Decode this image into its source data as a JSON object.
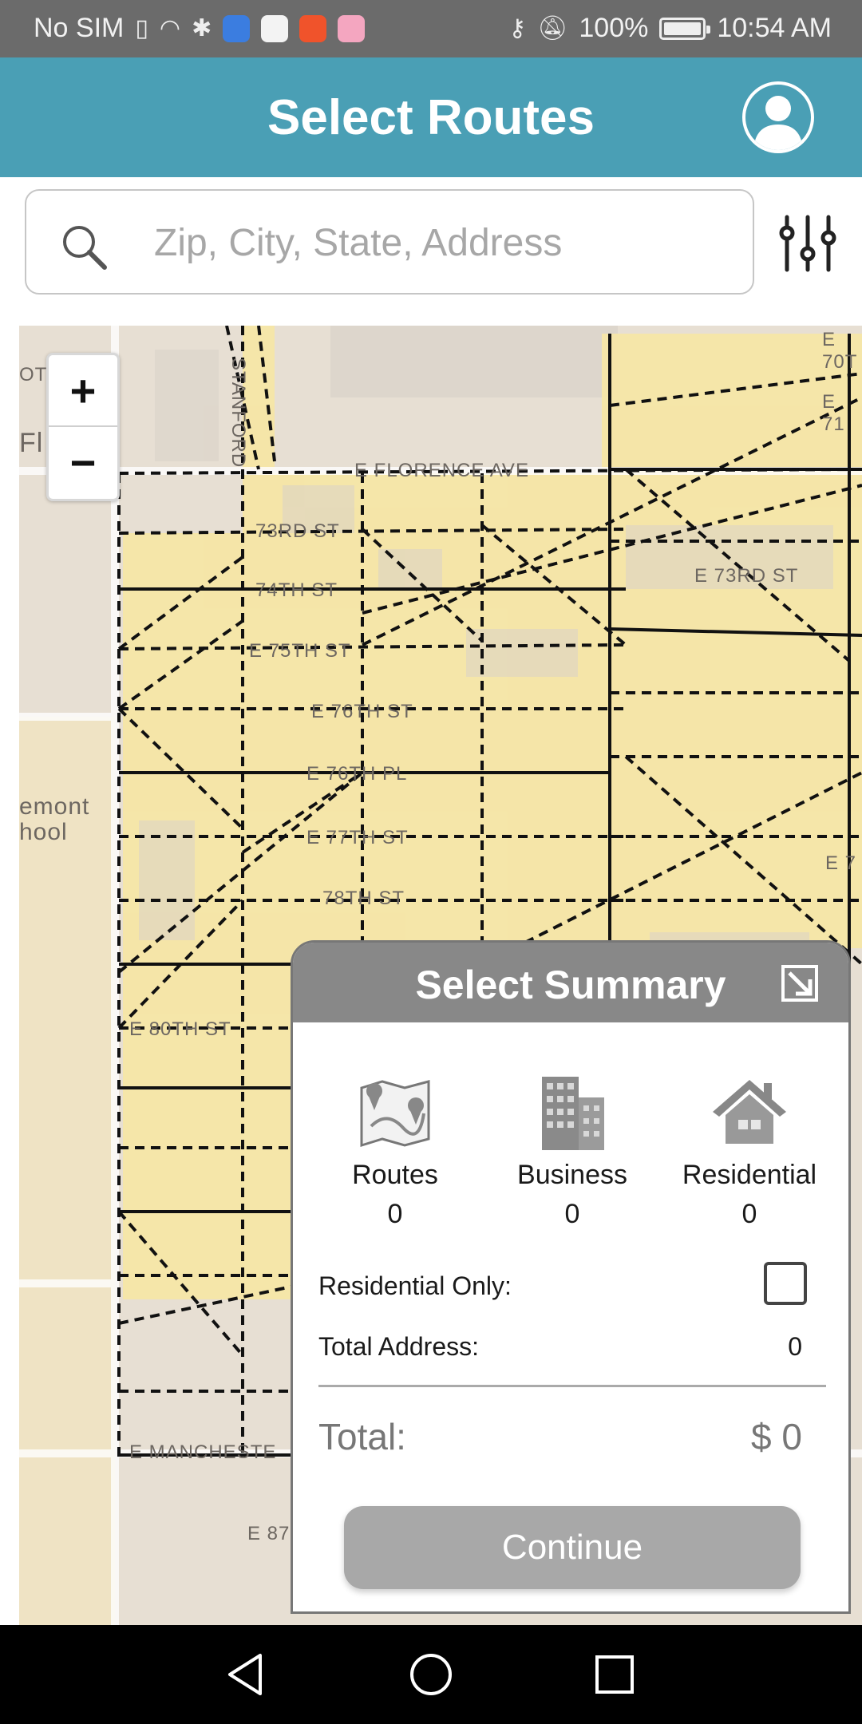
{
  "status_bar": {
    "carrier": "No SIM",
    "battery": "100%",
    "time": "10:54 AM",
    "background": "#6b6b6b"
  },
  "header": {
    "title": "Select Routes",
    "background": "#4a9fb5",
    "profile_icon": "user-avatar-icon"
  },
  "search": {
    "placeholder": "Zip, City, State, Address",
    "value": "",
    "icon": "search-icon",
    "filter_icon": "sliders-icon"
  },
  "map": {
    "zoom_in_label": "+",
    "zoom_out_label": "−",
    "labels": {
      "florence": "Fl    ce",
      "florence_ave": "E FLORENCE AVE",
      "st73": "73RD ST",
      "st74": "74TH ST",
      "st75": "E 75TH ST",
      "st76": "E 76TH ST",
      "st76pl": "E 76TH PL",
      "st77": "E 77TH ST",
      "st78": "78TH ST",
      "st80": "E 80TH ST",
      "manchester": "E MANCHESTE",
      "st87": "E 87",
      "st73b": "E 73RD ST",
      "school_1": "emont",
      "school_2": "hool",
      "oth": "OTH",
      "stanford": "STANFORD",
      "e70": "E 70T",
      "e71": "E 71",
      "e7": "E 7"
    },
    "route_fill": "#f6e6a6"
  },
  "summary": {
    "title": "Select Summary",
    "stats": [
      {
        "label": "Routes",
        "value": "0",
        "icon": "map-routes-icon"
      },
      {
        "label": "Business",
        "value": "0",
        "icon": "office-building-icon"
      },
      {
        "label": "Residential",
        "value": "0",
        "icon": "house-icon"
      }
    ],
    "residential_only_label": "Residential Only:",
    "residential_only_checked": false,
    "total_address_label": "Total Address:",
    "total_address_value": "0",
    "total_label": "Total:",
    "total_value": "$ 0",
    "continue_label": "Continue"
  },
  "nav_bar": {
    "back_icon": "triangle-back-icon",
    "home_icon": "circle-home-icon",
    "recents_icon": "square-recents-icon"
  }
}
